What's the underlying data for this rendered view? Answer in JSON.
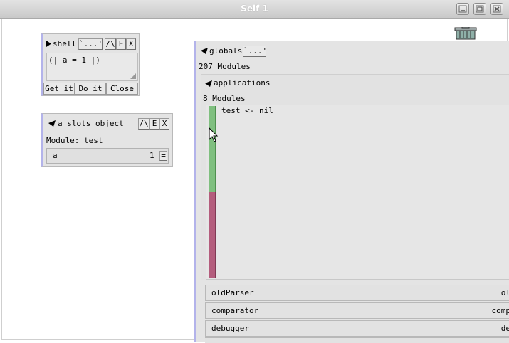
{
  "window": {
    "title": "Self 1"
  },
  "shell": {
    "title": "shell",
    "ellipsis_label": "`...'",
    "up_label": "/\\",
    "e_label": "E",
    "x_label": "X",
    "code": "(| a = 1 |)",
    "buttons": {
      "get_it": "Get it",
      "do_it": "Do it",
      "close": "Close"
    }
  },
  "slots_object": {
    "title": "a slots object",
    "up_label": "/\\",
    "e_label": "E",
    "x_label": "X",
    "module_label": "Module: test",
    "slot": {
      "name": "a",
      "value": "1",
      "equals_icon": "="
    }
  },
  "globals": {
    "title": "globals",
    "ellipsis_label": "`...'",
    "module_count": "207 Modules",
    "applications": {
      "title": "applications",
      "module_count": "8 Modules",
      "editor_text": "test <- nil",
      "status_colors": {
        "top": "#7fbf7f",
        "bottom": "#b45d7d"
      }
    },
    "rows": [
      {
        "name": "oldParser",
        "right": "ol"
      },
      {
        "name": "comparator",
        "right": "comp"
      },
      {
        "name": "debugger",
        "right": "de"
      }
    ]
  }
}
